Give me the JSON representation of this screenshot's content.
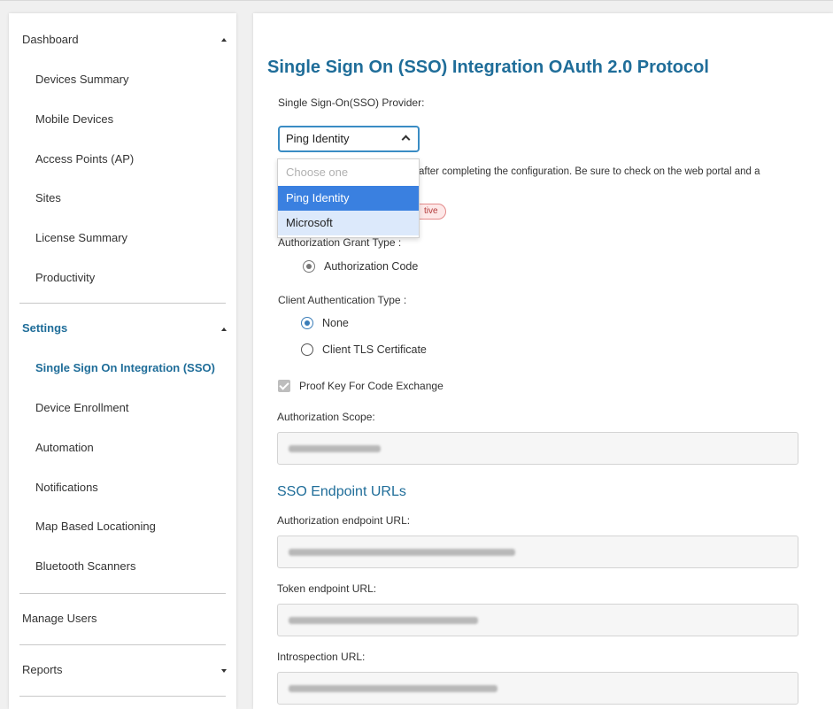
{
  "sidebar": {
    "dashboard": "Dashboard",
    "dashboard_items": [
      "Devices Summary",
      "Mobile Devices",
      "Access Points (AP)",
      "Sites",
      "License Summary",
      "Productivity"
    ],
    "settings": "Settings",
    "settings_items": [
      "Single Sign On Integration (SSO)",
      "Device Enrollment",
      "Automation",
      "Notifications",
      "Map Based Locationing",
      "Bluetooth Scanners"
    ],
    "manage_users": "Manage Users",
    "reports": "Reports"
  },
  "main": {
    "title": "Single Sign On (SSO) Integration OAuth 2.0 Protocol",
    "provider_label": "Single Sign-On(SSO) Provider:",
    "provider_value": "Ping Identity",
    "dropdown": {
      "placeholder": "Choose one",
      "options": [
        "Ping Identity",
        "Microsoft"
      ],
      "selected_index": 0,
      "hover_index": 1
    },
    "note_text": "after completing the configuration. Be sure to check on the web portal and a",
    "status_badge": "tive",
    "grant_type_label": "Authorization Grant Type :",
    "grant_type_option": "Authorization Code",
    "client_auth_label": "Client Authentication Type :",
    "client_auth_options": [
      "None",
      "Client TLS Certificate"
    ],
    "client_auth_selected": "None",
    "pkce_label": "Proof Key For Code Exchange",
    "pkce_checked": true,
    "scope_label": "Authorization Scope:",
    "endpoints_title": "SSO Endpoint URLs",
    "auth_endpoint_label": "Authorization endpoint URL:",
    "token_endpoint_label": "Token endpoint URL:",
    "introspection_label": "Introspection URL:"
  },
  "colors": {
    "accent": "#1f6d99",
    "selected_option": "#3a80e0",
    "hover_option": "#dce9fb",
    "badge_border": "#e38a8a"
  }
}
